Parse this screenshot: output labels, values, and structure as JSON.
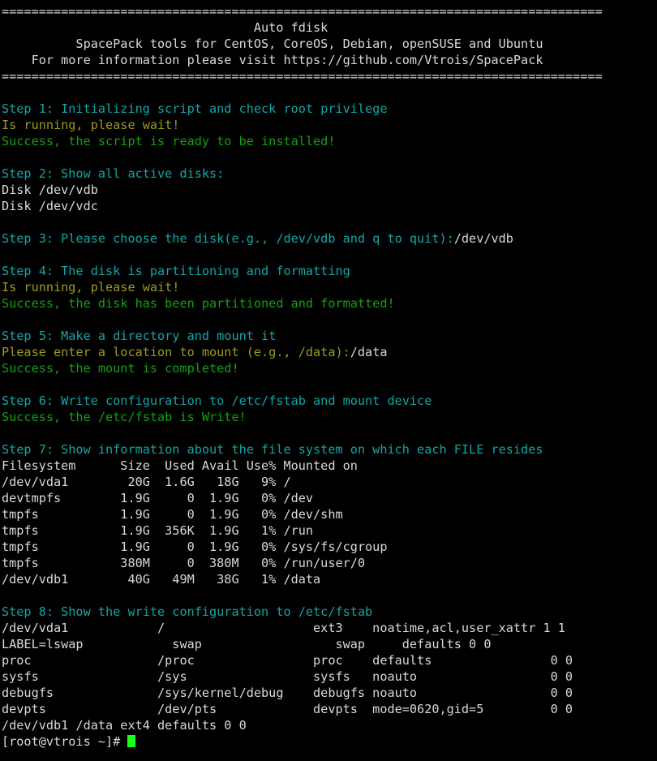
{
  "terminal": {
    "title": "Auto fdisk",
    "colors": {
      "background": "#000000",
      "foreground": "#d9d9d9",
      "cyan": "#12a6a6",
      "green": "#13a013",
      "yellow": "#9c9c19",
      "cursor": "#1aff1a"
    },
    "separator": "=================================================================================",
    "header": {
      "title": "                                  Auto fdisk",
      "subtitle": "          SpacePack tools for CentOS, CoreOS, Debian, openSUSE and Ubuntu",
      "info": "    For more information please visit https://github.com/Vtrois/SpacePack"
    },
    "steps": {
      "step1": {
        "heading": "Step 1: Initializing script and check root privilege",
        "running": "Is running, please wait!",
        "success": "Success, the script is ready to be installed!"
      },
      "step2": {
        "heading": "Step 2: Show all active disks:",
        "disks": [
          "Disk /dev/vdb",
          "Disk /dev/vdc"
        ]
      },
      "step3": {
        "prompt": "Step 3: Please choose the disk(e.g., /dev/vdb and q to quit):",
        "input": "/dev/vdb"
      },
      "step4": {
        "heading": "Step 4: The disk is partitioning and formatting",
        "running": "Is running, please wait!",
        "success": "Success, the disk has been partitioned and formatted!"
      },
      "step5": {
        "heading": "Step 5: Make a directory and mount it",
        "prompt": "Please enter a location to mount (e.g., /data):",
        "input": "/data",
        "success": "Success, the mount is completed!"
      },
      "step6": {
        "heading": "Step 6: Write configuration to /etc/fstab and mount device",
        "success": "Success, the /etc/fstab is Write!"
      },
      "step7": {
        "heading": "Step 7: Show information about the file system on which each FILE resides",
        "table_header": "Filesystem      Size  Used Avail Use% Mounted on",
        "rows": [
          "/dev/vda1        20G  1.6G   18G   9% /",
          "devtmpfs        1.9G     0  1.9G   0% /dev",
          "tmpfs           1.9G     0  1.9G   0% /dev/shm",
          "tmpfs           1.9G  356K  1.9G   1% /run",
          "tmpfs           1.9G     0  1.9G   0% /sys/fs/cgroup",
          "tmpfs           380M     0  380M   0% /run/user/0",
          "/dev/vdb1        40G   49M   38G   1% /data"
        ]
      },
      "step8": {
        "heading": "Step 8: Show the write configuration to /etc/fstab",
        "rows": [
          "/dev/vda1            /                    ext3    noatime,acl,user_xattr 1 1",
          "LABEL=lswap            swap                  swap     defaults 0 0",
          "proc                 /proc                proc    defaults                0 0",
          "sysfs                /sys                 sysfs   noauto                  0 0",
          "debugfs              /sys/kernel/debug    debugfs noauto                  0 0",
          "devpts               /dev/pts             devpts  mode=0620,gid=5         0 0",
          "/dev/vdb1 /data ext4 defaults 0 0"
        ]
      }
    },
    "prompt": {
      "text": "[root@vtrois ~]# "
    }
  }
}
